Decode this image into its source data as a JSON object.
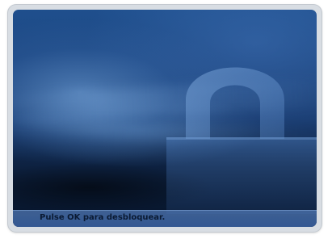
{
  "lock_screen": {
    "message": "Pulse OK para desbloquear.",
    "icon": "padlock-icon",
    "colors": {
      "background_top": "#1f4f8d",
      "background_bottom": "#061328",
      "status_bar": "#3c64a5",
      "message_text": "#0a1a33"
    }
  }
}
